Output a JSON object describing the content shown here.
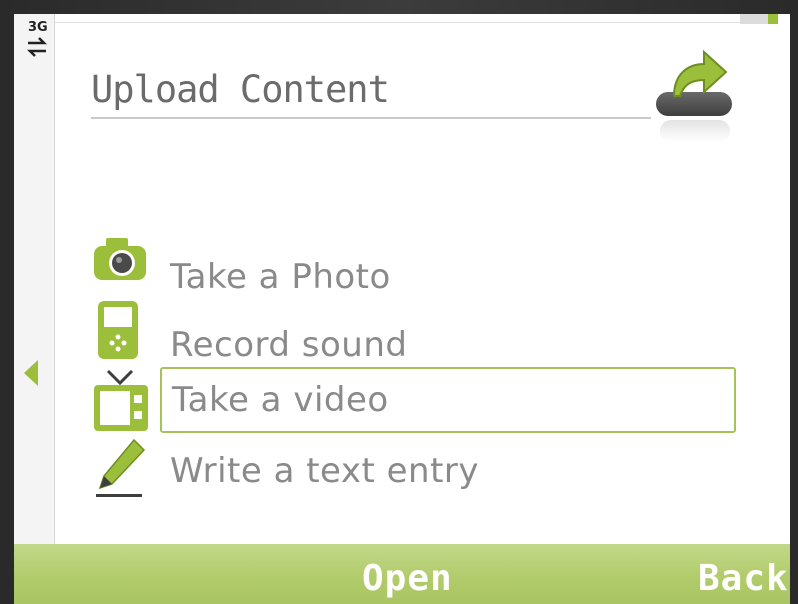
{
  "status": {
    "network": "3G"
  },
  "header": {
    "title": "Upload Content",
    "icon": "upload-arrow-icon"
  },
  "menu": {
    "items": [
      {
        "label": "Take a Photo",
        "icon": "camera-icon"
      },
      {
        "label": "Record sound",
        "icon": "audio-recorder-icon"
      },
      {
        "label": "Take a video",
        "icon": "video-tv-icon",
        "selected": true
      },
      {
        "label": "Write a text entry",
        "icon": "pencil-icon"
      }
    ]
  },
  "softkeys": {
    "left": "Open",
    "right": "Back"
  },
  "colors": {
    "accent": "#9bbf3a",
    "softkey_bar": "#b3cd6e",
    "text": "#8a8a8a"
  }
}
